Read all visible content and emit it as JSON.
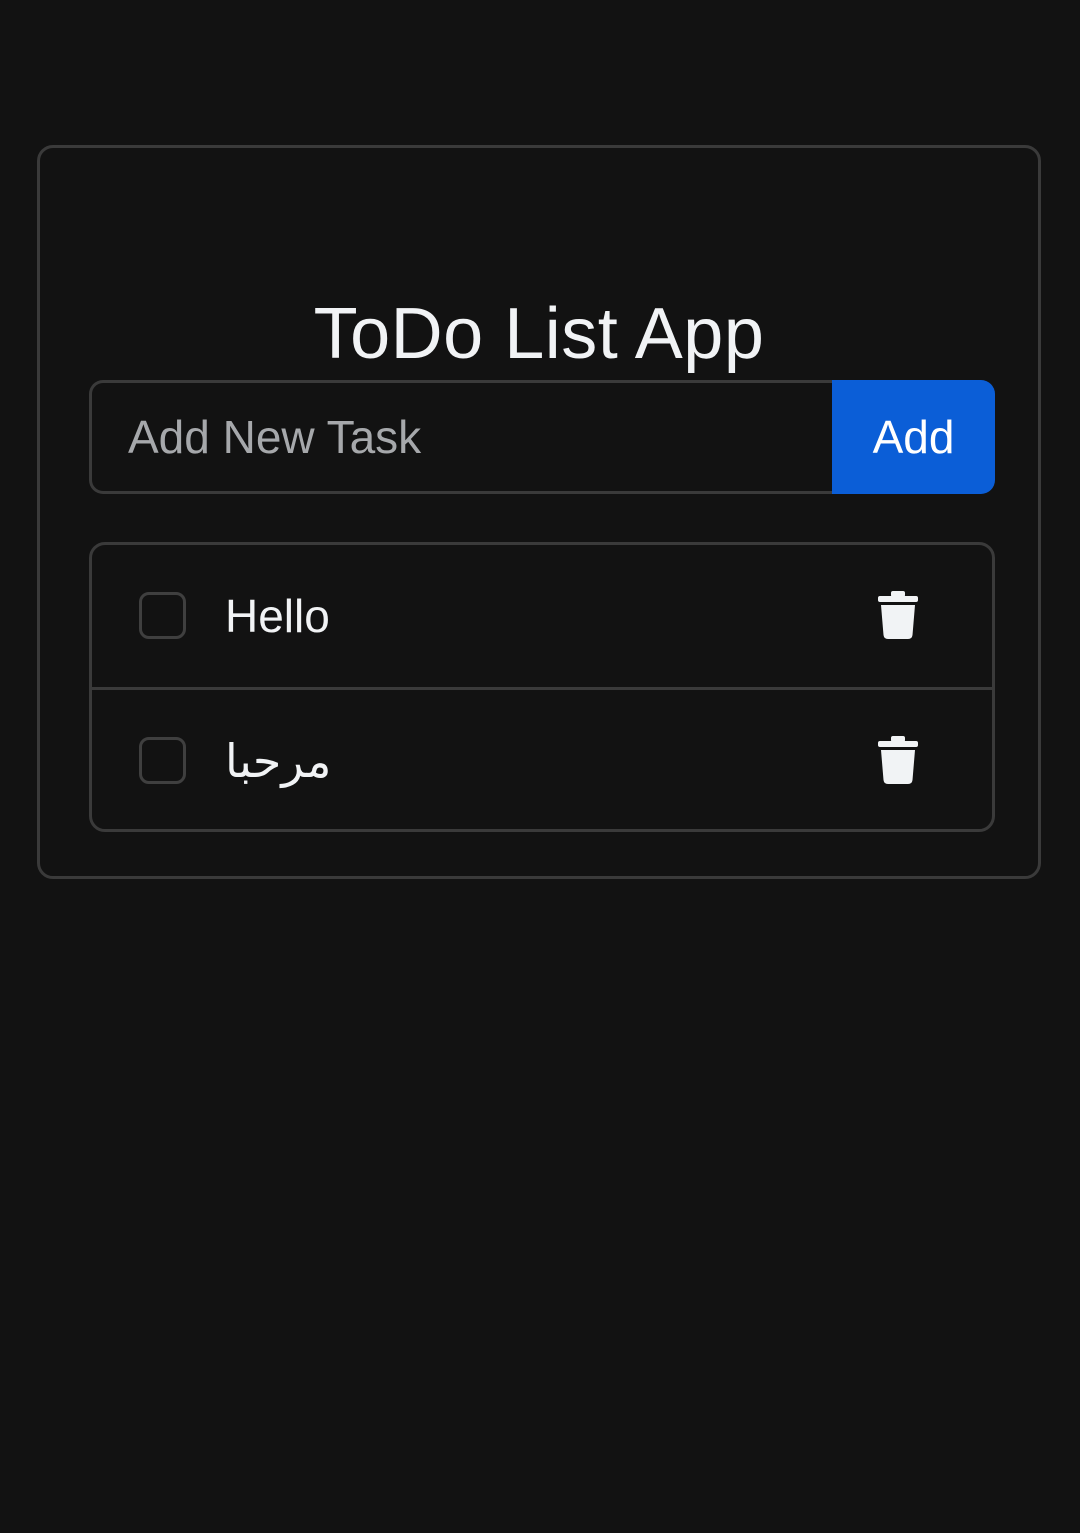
{
  "app": {
    "title": "ToDo List App"
  },
  "new_task": {
    "placeholder": "Add New Task",
    "value": "",
    "add_label": "Add"
  },
  "tasks": [
    {
      "text": "Hello",
      "completed": false,
      "delete_icon": "trash-icon"
    },
    {
      "text": "مرحبا",
      "completed": false,
      "delete_icon": "trash-icon"
    }
  ],
  "colors": {
    "background": "#121212",
    "border": "#3a3a3a",
    "accent": "#0b5ed7",
    "text": "#f1f3f5",
    "placeholder": "#a6a8ab"
  }
}
